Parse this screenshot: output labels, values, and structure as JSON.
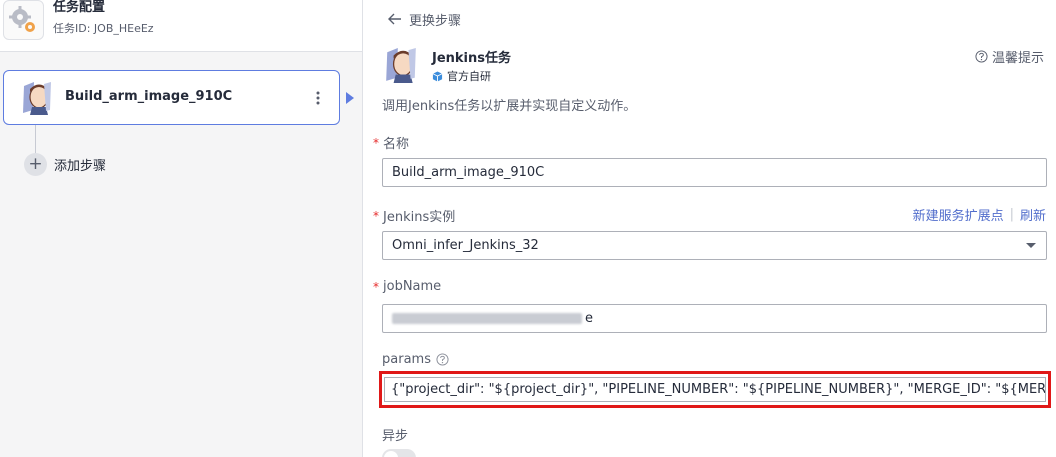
{
  "task": {
    "title": "任务配置",
    "id_text": "任务ID: JOB_HEeEz"
  },
  "pipeline": {
    "step_name": "Build_arm_image_910C",
    "add_step_label": "添加步骤"
  },
  "detail": {
    "back_label": "更换步骤",
    "plugin_title": "Jenkins任务",
    "plugin_badge": "官方自研",
    "tip_label": "温馨提示",
    "description": "调用Jenkins任务以扩展并实现自定义动作。",
    "fields": {
      "name_label": "名称",
      "name_value": "Build_arm_image_910C",
      "instance_label": "Jenkins实例",
      "instance_value": "Omni_infer_Jenkins_32",
      "new_extension_link": "新建服务扩展点",
      "refresh_link": "刷新",
      "jobname_label": "jobName",
      "jobname_visible_suffix": "e",
      "params_label": "params",
      "params_value": "{\"project_dir\": \"${project_dir}\", \"PIPELINE_NUMBER\": \"${PIPELINE_NUMBER}\", \"MERGE_ID\": \"${MERGE_ID}\",\"RE",
      "async_label": "异步"
    }
  },
  "colors": {
    "accent": "#5e7ce0",
    "link": "#526ecc",
    "required": "#e62c2c",
    "highlight_border": "#e01818"
  }
}
